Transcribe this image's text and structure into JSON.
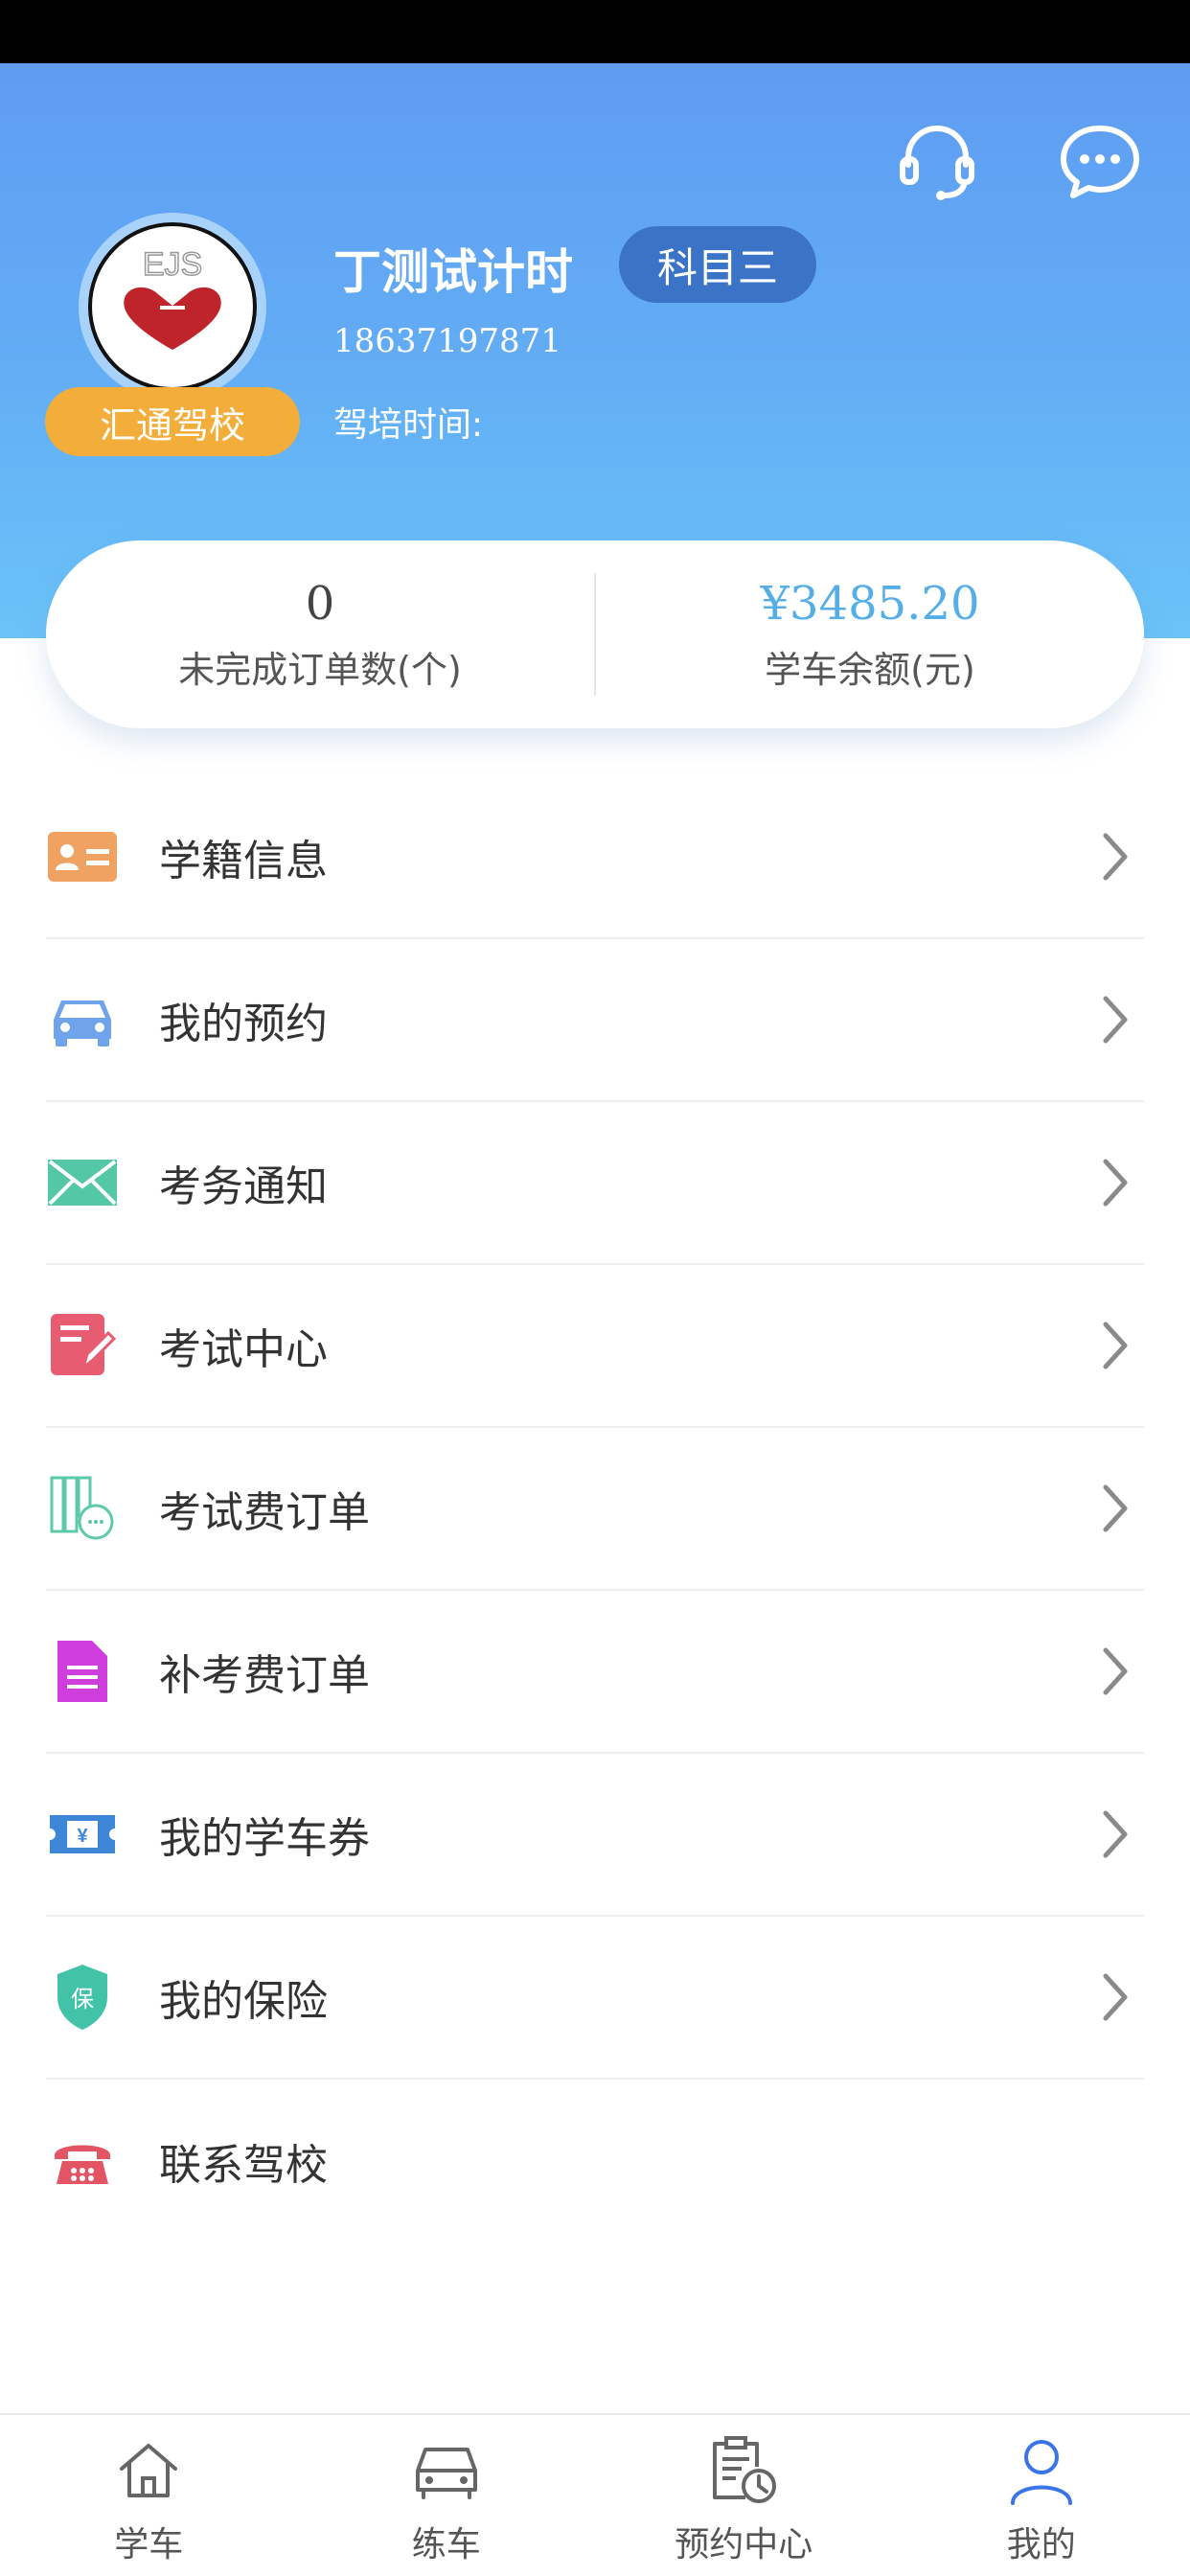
{
  "profile": {
    "name": "丁测试计时",
    "subject": "科目三",
    "phone": "18637197871",
    "school": "汇通驾校",
    "train_time_label": "驾培时间:"
  },
  "stats": {
    "pending_orders_value": "0",
    "pending_orders_label": "未完成订单数(个)",
    "balance_value": "¥3485.20",
    "balance_label": "学车余额(元)"
  },
  "menu": {
    "items": [
      {
        "label": "学籍信息",
        "icon": "id-card-icon",
        "color": "#f0a262"
      },
      {
        "label": "我的预约",
        "icon": "car-icon",
        "color": "#6fa4ea"
      },
      {
        "label": "考务通知",
        "icon": "envelope-icon",
        "color": "#54c7a6"
      },
      {
        "label": "考试中心",
        "icon": "edit-icon",
        "color": "#e85c72"
      },
      {
        "label": "考试费订单",
        "icon": "receipt-icon",
        "color": "#5cc9a8"
      },
      {
        "label": "补考费订单",
        "icon": "document-icon",
        "color": "#cf3ddc"
      },
      {
        "label": "我的学车券",
        "icon": "coupon-icon",
        "color": "#3d86d8"
      },
      {
        "label": "我的保险",
        "icon": "shield-icon",
        "color": "#42c3a8"
      },
      {
        "label": "联系驾校",
        "icon": "phone-icon",
        "color": "#e35464"
      }
    ]
  },
  "tabbar": {
    "items": [
      {
        "label": "学车",
        "icon": "home-icon"
      },
      {
        "label": "练车",
        "icon": "car-outline-icon"
      },
      {
        "label": "预约中心",
        "icon": "schedule-icon"
      },
      {
        "label": "我的",
        "icon": "user-icon",
        "active": true
      }
    ]
  },
  "colors": {
    "header_top": "#5f9cf2",
    "header_bottom": "#6ac3f8",
    "school_badge": "#f3ad3b",
    "subject_badge": "#3b74c6",
    "balance": "#55aee8",
    "active_tab": "#3b74e8"
  }
}
